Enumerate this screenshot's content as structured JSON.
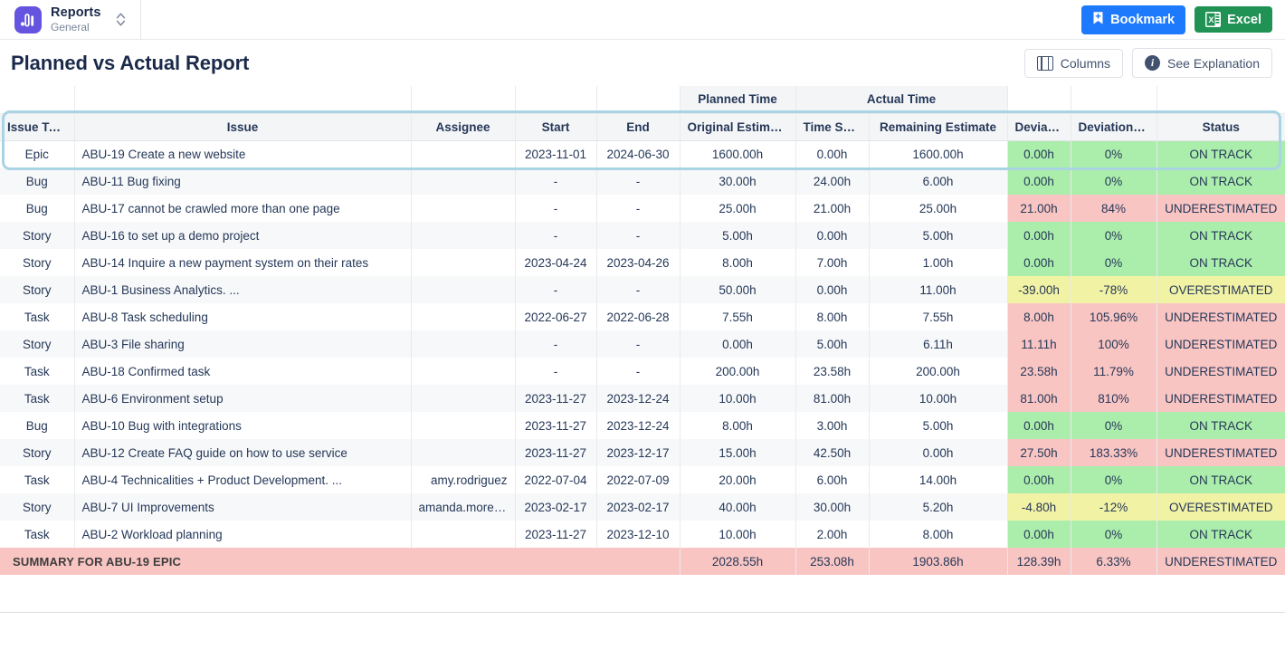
{
  "topbar": {
    "brand_title": "Reports",
    "brand_subtitle": "General",
    "logo_icon": "bar-chart-icon",
    "switcher_icon": "chevron-up-down-icon",
    "bookmark_label": "Bookmark",
    "bookmark_icon": "bookmark-icon",
    "bookmark_color": "#1d7afc",
    "excel_label": "Excel",
    "excel_icon": "excel-icon",
    "excel_color": "#1f9254"
  },
  "page": {
    "title": "Planned vs Actual Report",
    "columns_label": "Columns",
    "columns_icon": "columns-icon",
    "explanation_label": "See Explanation",
    "explanation_icon": "info-icon"
  },
  "table": {
    "group_headers": {
      "planned": "Planned Time",
      "actual": "Actual Time"
    },
    "columns": [
      "Issue Type",
      "Issue",
      "Assignee",
      "Start",
      "End",
      "Original Estimate",
      "Time Spent",
      "Remaining Estimate",
      "Deviation",
      "Deviation, %",
      "Status"
    ],
    "rows": [
      {
        "type": "Epic",
        "issue": "ABU-19 Create a new website",
        "assignee": "",
        "start": "2023-11-01",
        "end": "2024-06-30",
        "orig": "1600.00h",
        "spent": "0.00h",
        "remaining": "1600.00h",
        "dev": "0.00h",
        "devpct": "0%",
        "status": "ON TRACK",
        "state": "green"
      },
      {
        "type": "Bug",
        "issue": "ABU-11 Bug fixing",
        "assignee": "",
        "start": "-",
        "end": "-",
        "orig": "30.00h",
        "spent": "24.00h",
        "remaining": "6.00h",
        "dev": "0.00h",
        "devpct": "0%",
        "status": "ON TRACK",
        "state": "green"
      },
      {
        "type": "Bug",
        "issue": "ABU-17 cannot be crawled more than one page",
        "assignee": "",
        "start": "-",
        "end": "-",
        "orig": "25.00h",
        "spent": "21.00h",
        "remaining": "25.00h",
        "dev": "21.00h",
        "devpct": "84%",
        "status": "UNDERESTIMATED",
        "state": "red"
      },
      {
        "type": "Story",
        "issue": "ABU-16 to set up a demo project",
        "assignee": "",
        "start": "-",
        "end": "-",
        "orig": "5.00h",
        "spent": "0.00h",
        "remaining": "5.00h",
        "dev": "0.00h",
        "devpct": "0%",
        "status": "ON TRACK",
        "state": "green"
      },
      {
        "type": "Story",
        "issue": "ABU-14 Inquire a new payment system on their rates",
        "assignee": "",
        "start": "2023-04-24",
        "end": "2023-04-26",
        "orig": "8.00h",
        "spent": "7.00h",
        "remaining": "1.00h",
        "dev": "0.00h",
        "devpct": "0%",
        "status": "ON TRACK",
        "state": "green"
      },
      {
        "type": "Story",
        "issue": "ABU-1 Business Analytics. ...",
        "assignee": "",
        "start": "-",
        "end": "-",
        "orig": "50.00h",
        "spent": "0.00h",
        "remaining": "11.00h",
        "dev": "-39.00h",
        "devpct": "-78%",
        "status": "OVERESTIMATED",
        "state": "yellow"
      },
      {
        "type": "Task",
        "issue": "ABU-8 Task scheduling",
        "assignee": "",
        "start": "2022-06-27",
        "end": "2022-06-28",
        "orig": "7.55h",
        "spent": "8.00h",
        "remaining": "7.55h",
        "dev": "8.00h",
        "devpct": "105.96%",
        "status": "UNDERESTIMATED",
        "state": "red"
      },
      {
        "type": "Story",
        "issue": "ABU-3 File sharing",
        "assignee": "",
        "start": "-",
        "end": "-",
        "orig": "0.00h",
        "spent": "5.00h",
        "remaining": "6.11h",
        "dev": "11.11h",
        "devpct": "100%",
        "status": "UNDERESTIMATED",
        "state": "red"
      },
      {
        "type": "Task",
        "issue": "ABU-18 Confirmed task",
        "assignee": "",
        "start": "-",
        "end": "-",
        "orig": "200.00h",
        "spent": "23.58h",
        "remaining": "200.00h",
        "dev": "23.58h",
        "devpct": "11.79%",
        "status": "UNDERESTIMATED",
        "state": "red"
      },
      {
        "type": "Task",
        "issue": "ABU-6 Environment setup",
        "assignee": "",
        "start": "2023-11-27",
        "end": "2023-12-24",
        "orig": "10.00h",
        "spent": "81.00h",
        "remaining": "10.00h",
        "dev": "81.00h",
        "devpct": "810%",
        "status": "UNDERESTIMATED",
        "state": "red"
      },
      {
        "type": "Bug",
        "issue": "ABU-10 Bug with integrations",
        "assignee": "",
        "start": "2023-11-27",
        "end": "2023-12-24",
        "orig": "8.00h",
        "spent": "3.00h",
        "remaining": "5.00h",
        "dev": "0.00h",
        "devpct": "0%",
        "status": "ON TRACK",
        "state": "green"
      },
      {
        "type": "Story",
        "issue": "ABU-12 Create FAQ guide on how to use service",
        "assignee": "",
        "start": "2023-11-27",
        "end": "2023-12-17",
        "orig": "15.00h",
        "spent": "42.50h",
        "remaining": "0.00h",
        "dev": "27.50h",
        "devpct": "183.33%",
        "status": "UNDERESTIMATED",
        "state": "red"
      },
      {
        "type": "Task",
        "issue": "ABU-4 Technicalities + Product Development. ...",
        "assignee": "amy.rodriguez",
        "start": "2022-07-04",
        "end": "2022-07-09",
        "orig": "20.00h",
        "spent": "6.00h",
        "remaining": "14.00h",
        "dev": "0.00h",
        "devpct": "0%",
        "status": "ON TRACK",
        "state": "green"
      },
      {
        "type": "Story",
        "issue": "ABU-7 UI Improvements",
        "assignee": "amanda.moreno",
        "start": "2023-02-17",
        "end": "2023-02-17",
        "orig": "40.00h",
        "spent": "30.00h",
        "remaining": "5.20h",
        "dev": "-4.80h",
        "devpct": "-12%",
        "status": "OVERESTIMATED",
        "state": "yellow"
      },
      {
        "type": "Task",
        "issue": "ABU-2 Workload planning",
        "assignee": "",
        "start": "2023-11-27",
        "end": "2023-12-10",
        "orig": "10.00h",
        "spent": "2.00h",
        "remaining": "8.00h",
        "dev": "0.00h",
        "devpct": "0%",
        "status": "ON TRACK",
        "state": "green"
      }
    ],
    "summary": {
      "label": "SUMMARY FOR ABU-19 EPIC",
      "orig": "2028.55h",
      "spent": "253.08h",
      "remaining": "1903.86h",
      "dev": "128.39h",
      "devpct": "6.33%",
      "status": "UNDERESTIMATED",
      "state": "red"
    }
  },
  "colors": {
    "on_track": "#abedab",
    "underestimated": "#f9c5c3",
    "overestimated": "#f2f2a5",
    "highlight_ring": "#a8d4e4"
  }
}
